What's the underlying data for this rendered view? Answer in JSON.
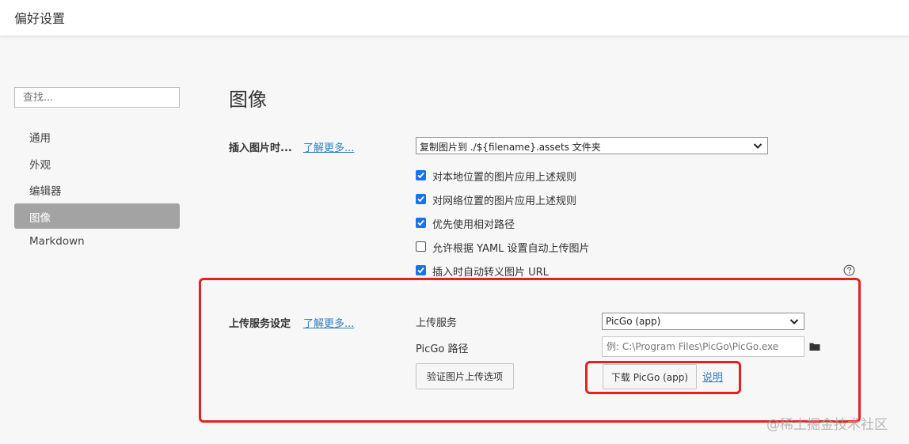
{
  "window": {
    "title": "偏好设置"
  },
  "sidebar": {
    "search_placeholder": "查找...",
    "items": [
      {
        "label": "通用"
      },
      {
        "label": "外观"
      },
      {
        "label": "编辑器"
      },
      {
        "label": "图像",
        "active": true
      },
      {
        "label": "Markdown"
      }
    ]
  },
  "main": {
    "section_title": "图像",
    "insert_image": {
      "label": "插入图片时...",
      "learn_more": "了解更多...",
      "selected_option": "复制图片到 ./${filename}.assets 文件夹",
      "options": [
        {
          "label": "对本地位置的图片应用上述规则",
          "checked": true
        },
        {
          "label": "对网络位置的图片应用上述规则",
          "checked": true
        },
        {
          "label": "优先使用相对路径",
          "checked": true
        },
        {
          "label": "允许根据 YAML 设置自动上传图片",
          "checked": false
        },
        {
          "label": "插入时自动转义图片 URL",
          "checked": true
        }
      ]
    },
    "upload": {
      "label": "上传服务设定",
      "learn_more": "了解更多...",
      "service_label": "上传服务",
      "service_value": "PicGo (app)",
      "path_label": "PicGo 路径",
      "path_placeholder": "例: C:\\Program Files\\PicGo\\PicGo.exe",
      "verify_button": "验证图片上传选项",
      "download_button": "下载 PicGo (app)",
      "explain_link": "说明"
    }
  },
  "watermark": "@稀土掘金技术社区",
  "icons": {
    "help": "help-circle-icon",
    "folder": "folder-icon",
    "chevron": "chevron-down-icon",
    "checkbox": "check-icon"
  },
  "colors": {
    "accent": "#1a73e8",
    "link": "#2f7fc1",
    "active_nav": "#a3a3a3",
    "highlight": "#e8201a"
  }
}
